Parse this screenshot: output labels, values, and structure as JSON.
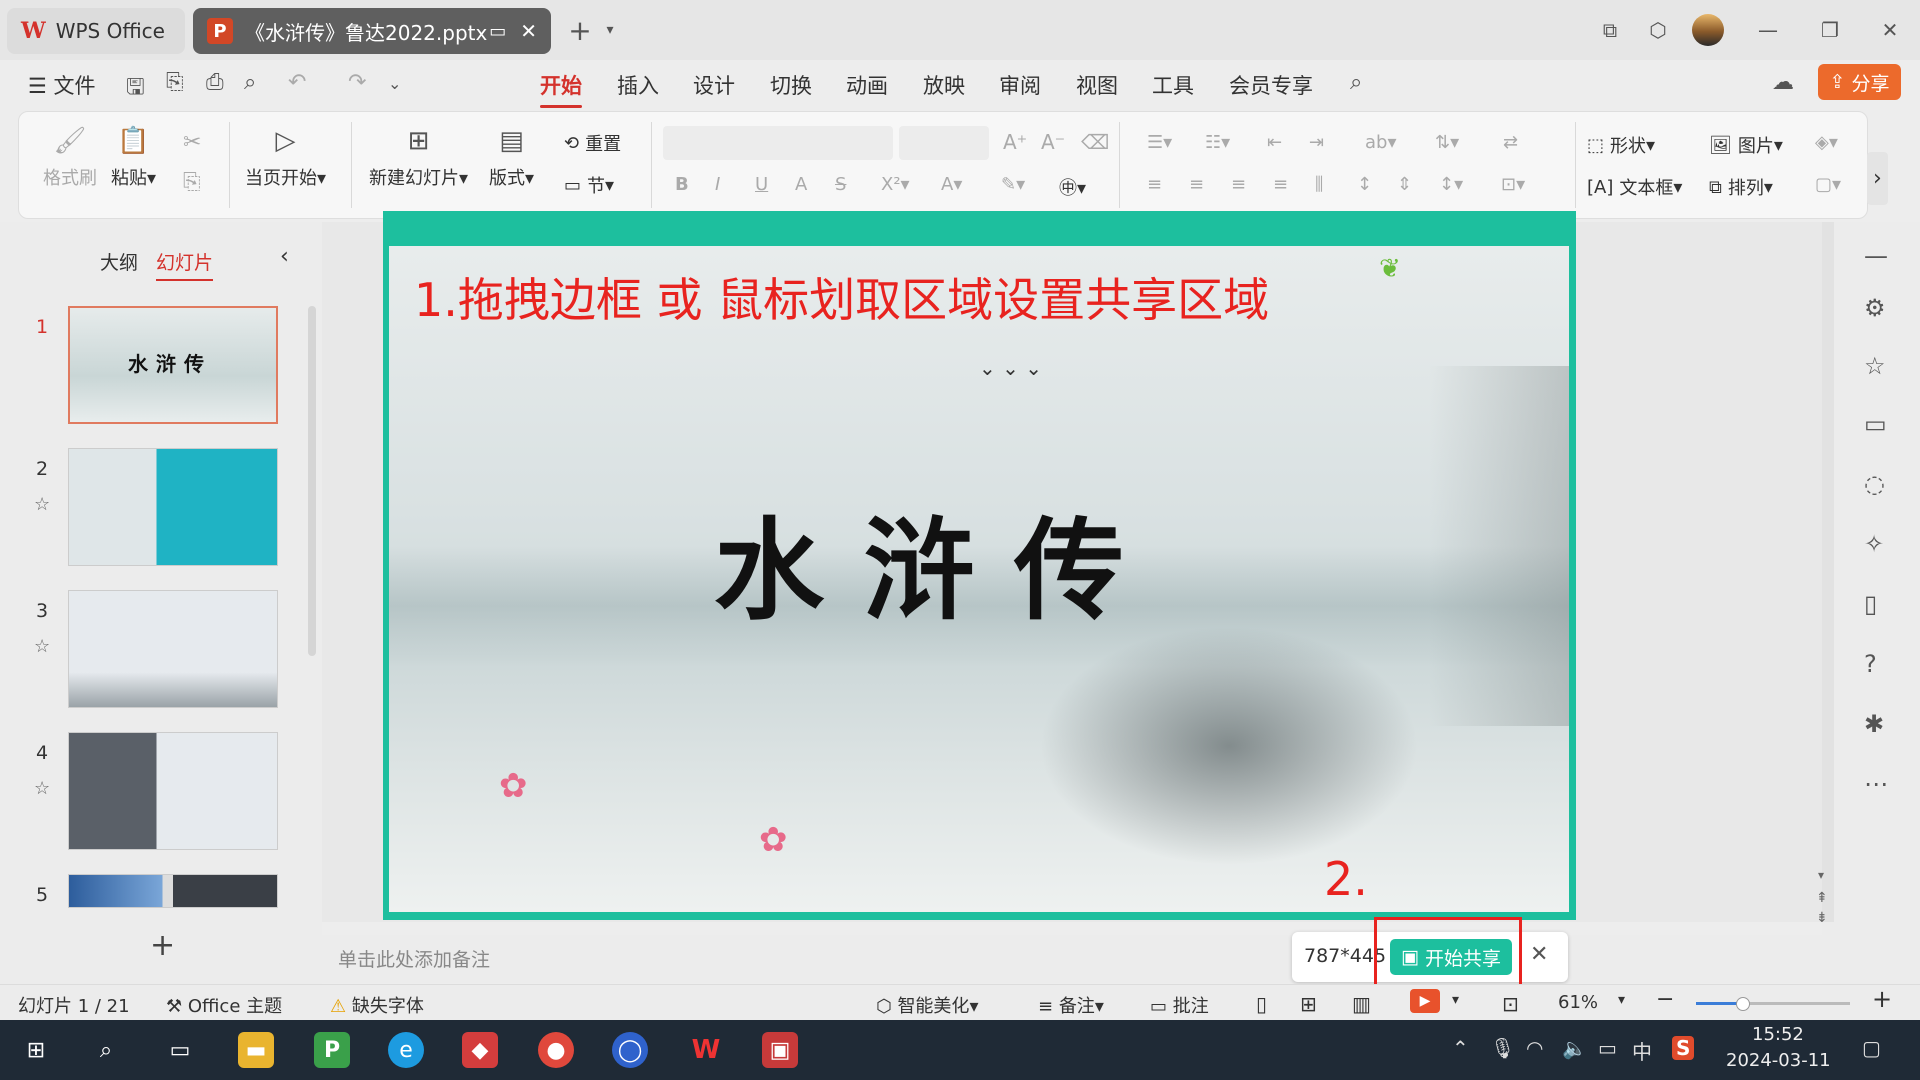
{
  "tabs": {
    "wps_office": "WPS Office",
    "document": "《水浒传》鲁达2022.pptx"
  },
  "menu": {
    "file": "文件",
    "items": [
      "开始",
      "插入",
      "设计",
      "切换",
      "动画",
      "放映",
      "审阅",
      "视图",
      "工具",
      "会员专享"
    ],
    "active": "开始",
    "share": "分享"
  },
  "ribbon": {
    "format_painter": "格式刷",
    "paste": "粘贴",
    "from_current": "当页开始",
    "new_slide": "新建幻灯片",
    "layout": "版式",
    "reset": "重置",
    "section": "节",
    "shape": "形状",
    "picture": "图片",
    "textbox": "文本框",
    "arrange": "排列"
  },
  "panel": {
    "outline_tab": "大纲",
    "slides_tab": "幻灯片",
    "slide_numbers": [
      "1",
      "2",
      "3",
      "4",
      "5"
    ],
    "slide1_title": "水浒传"
  },
  "slide": {
    "instruction": "1.拖拽边框 或 鼠标划取区域设置共享区域",
    "title": "水浒传",
    "step2": "2."
  },
  "notes_placeholder": "单击此处添加备注",
  "share_popup": {
    "size": "787*445",
    "start_label": "开始共享"
  },
  "status": {
    "slide_counter": "幻灯片 1 / 21",
    "theme": "Office 主题",
    "missing_font": "缺失字体",
    "beautify": "智能美化",
    "notes": "备注",
    "comments": "批注",
    "zoom": "61%"
  },
  "taskbar": {
    "time": "15:52",
    "date": "2024-03-11",
    "ime": "中"
  },
  "colors": {
    "accent_red": "#d4322c",
    "share_green": "#1dbf9e",
    "share_orange": "#ec6a2c",
    "annotation_red": "#e8231f"
  }
}
